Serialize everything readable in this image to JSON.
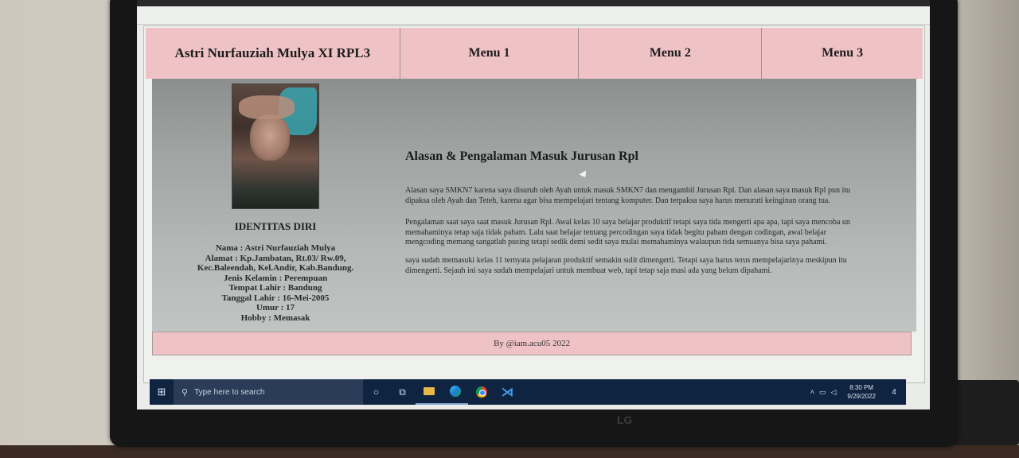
{
  "site": {
    "owner_title": "Astri Nurfauziah Mulya XI RPL3",
    "menus": [
      "Menu 1",
      "Menu 2",
      "Menu 3"
    ]
  },
  "sidebar": {
    "heading": "IDENTITAS DIRI",
    "info_lines": [
      "Nama : Astri Nurfauziah Mulya",
      "Alamat : Kp.Jambatan, Rt.03/ Rw.09,",
      "Kec.Baleendah, Kel.Andir, Kab.Bandung.",
      "Jenis Kelamin : Perempuan",
      "Tempat Lahir : Bandung",
      "Tanggal Lahir : 16-Mei-2005",
      "Umur : 17",
      "Hobby : Memasak"
    ]
  },
  "main": {
    "title": "Alasan & Pengalaman Masuk Jurusan Rpl",
    "paragraphs": [
      "Alasan saya SMKN7 karena saya disuruh oleh Ayah untuk masuk SMKN7 dan mengambil Jurusan Rpl. Dan alasan saya masuk Rpl pun itu\ndipaksa oleh Ayah dan Teteh, karena agar bisa mempelajari tentang komputer. Dan terpaksa saya harus menuruti keinginan orang tua.",
      "Pengalaman saat saya saat masuk Jurusan Rpl. Awal kelas 10 saya belajar produktif tetapi saya tida mengerti apa apa, tapi saya mencoba un\nmemahaminya tetap saja tidak paham. Lalu saat belajar tentang percodingan saya tidak begitu paham dengan codingan, awal belajar\nmengcoding memang sangatlah pusing tetapi sedik demi sedit saya mulai memahaminya walaupun tida semuanya bisa saya pahami.",
      "saya sudah memasuki kelas 11 ternyata pelajaran produktif semakin sulit dimengerti. Tetapi saya harus terus mempelajarinya meskipun itu\ndimengerti. Sejauh ini saya sudah mempelajari untuk membuat web, tapi tetap saja masi ada yang belum dipahami."
    ]
  },
  "footer": {
    "credit": "By @iam.acu05 2022"
  },
  "taskbar": {
    "search_placeholder": "Type here to search",
    "time": "8:30 PM",
    "date": "9/29/2022",
    "notification_count": "4"
  },
  "monitor": {
    "brand": "LG"
  },
  "colors": {
    "header_pink": "#efc3c6",
    "taskbar_blue": "#0f2440"
  }
}
